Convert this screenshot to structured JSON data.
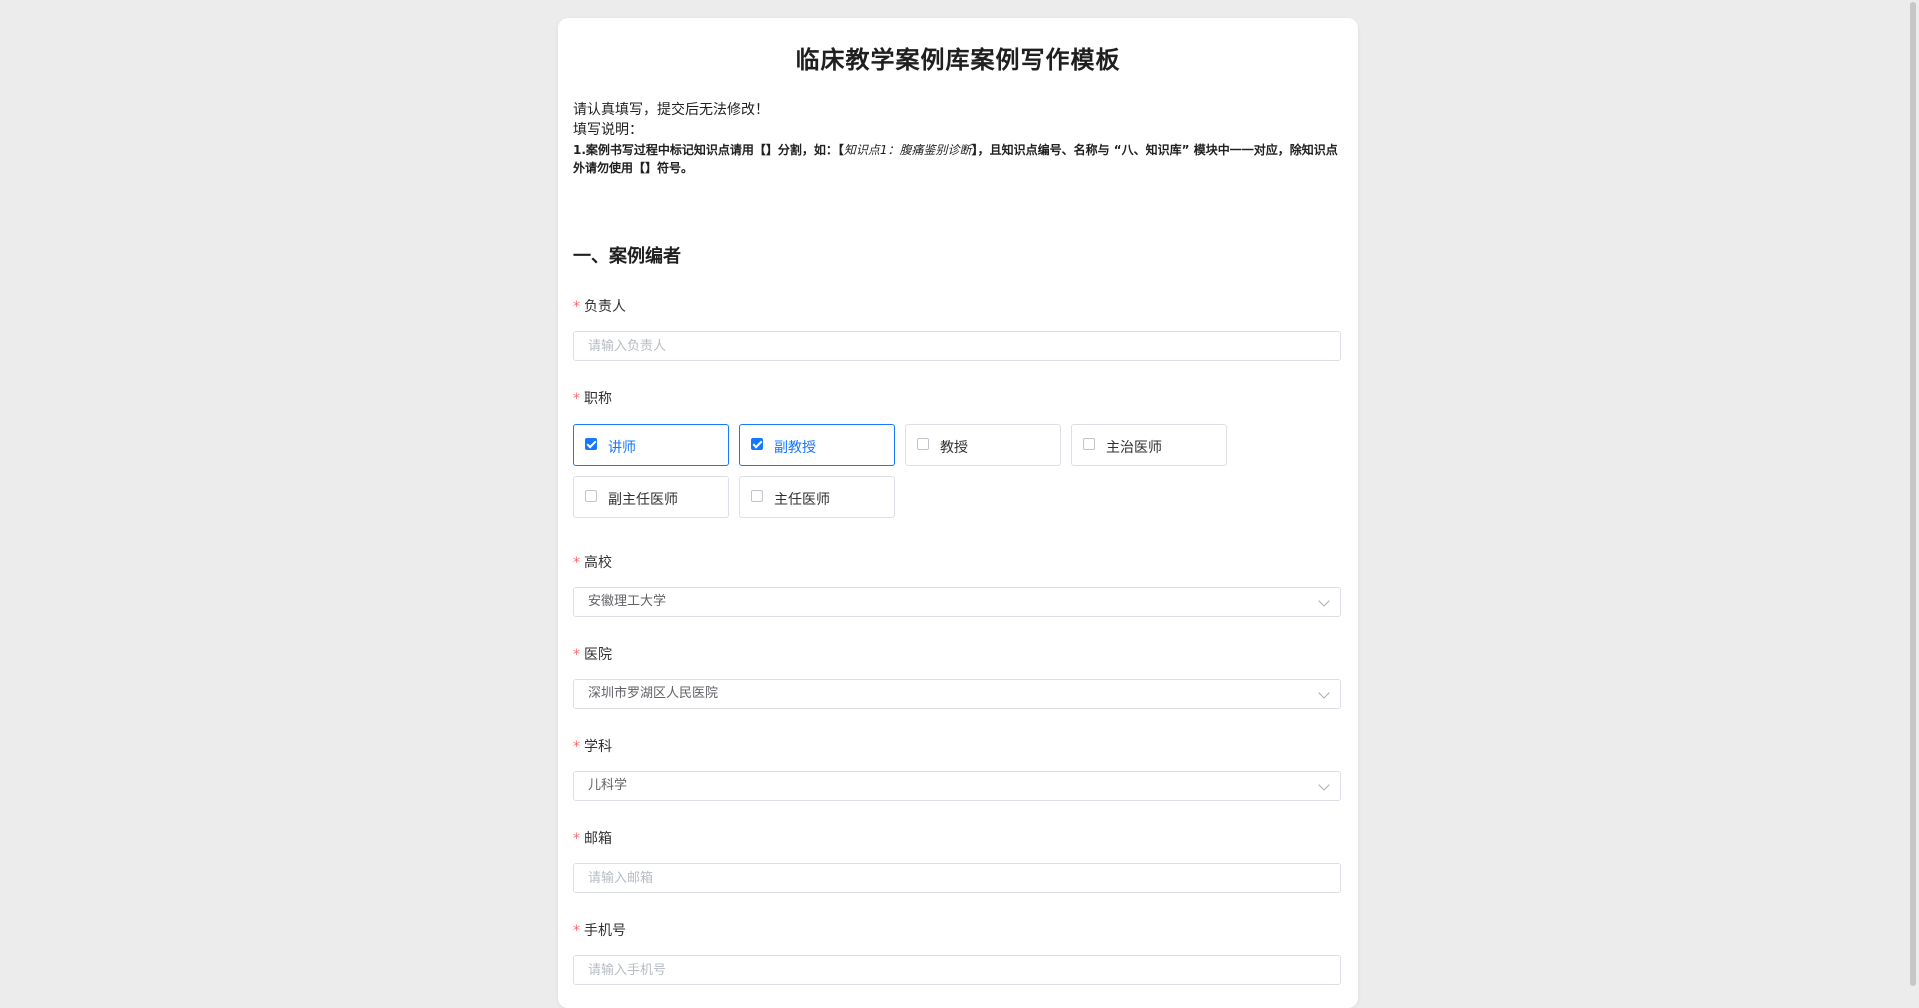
{
  "form": {
    "title": "临床教学案例库案例写作模板",
    "notice": "请认真填写，提交后无法修改！",
    "instructions_heading": "填写说明：",
    "instruction_1_a": "1.案例书写过程中标记知识点请用【】分割，如：【",
    "instruction_1_example": "知识点1：腹痛鉴别诊断",
    "instruction_1_b": "】，且知识点编号、名称与 “八、知识库” 模块中一一对应，除知识点外请勿使用【】符号。"
  },
  "section1": {
    "title": "一、案例编者",
    "required_mark": "*",
    "owner": {
      "label": "负责人",
      "placeholder": "请输入负责人",
      "value": ""
    },
    "job_title": {
      "label": "职称",
      "options": [
        {
          "label": "讲师",
          "checked": true
        },
        {
          "label": "副教授",
          "checked": true
        },
        {
          "label": "教授",
          "checked": false
        },
        {
          "label": "主治医师",
          "checked": false
        },
        {
          "label": "副主任医师",
          "checked": false
        },
        {
          "label": "主任医师",
          "checked": false
        }
      ]
    },
    "university": {
      "label": "高校",
      "value": "安徽理工大学"
    },
    "hospital": {
      "label": "医院",
      "value": "深圳市罗湖区人民医院"
    },
    "discipline": {
      "label": "学科",
      "value": "儿科学"
    },
    "email": {
      "label": "邮箱",
      "placeholder": "请输入邮箱",
      "value": ""
    },
    "phone": {
      "label": "手机号",
      "placeholder": "请输入手机号",
      "value": ""
    }
  },
  "colors": {
    "accent": "#1677ff",
    "required": "#f56c6c",
    "border": "#dcdfe6",
    "page_bg": "#ececec"
  }
}
